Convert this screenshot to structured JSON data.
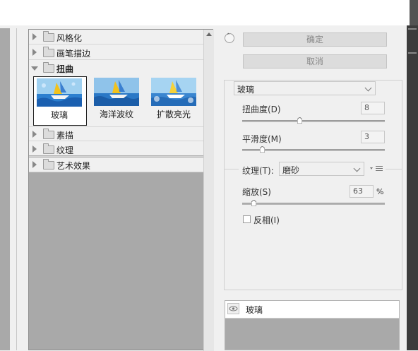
{
  "filter_tree": {
    "folders": [
      {
        "label": "风格化",
        "expanded": false
      },
      {
        "label": "画笔描边",
        "expanded": false
      },
      {
        "label": "扭曲",
        "expanded": true
      },
      {
        "label": "素描",
        "expanded": false
      },
      {
        "label": "纹理",
        "expanded": false
      },
      {
        "label": "艺术效果",
        "expanded": false
      }
    ],
    "thumbnails": [
      {
        "label": "玻璃",
        "selected": true
      },
      {
        "label": "海洋波纹",
        "selected": false
      },
      {
        "label": "扩散亮光",
        "selected": false
      }
    ]
  },
  "buttons": {
    "ok_label": "确定",
    "cancel_label": "取消"
  },
  "settings": {
    "filter_select": "玻璃",
    "distortion": {
      "label": "扭曲度(D)",
      "value": "8",
      "level": 0.4
    },
    "smoothness": {
      "label": "平滑度(M)",
      "value": "3",
      "level": 0.14
    },
    "texture": {
      "label": "纹理(T):",
      "value": "磨砂"
    },
    "scaling": {
      "label": "缩放(S)",
      "value": "63",
      "unit": "%",
      "level": 0.08
    },
    "invert": {
      "label": "反相(I)",
      "checked": false
    }
  },
  "layers": {
    "items": [
      {
        "name": "玻璃",
        "visible": true
      }
    ]
  },
  "colors": {
    "panel": "#f0f0f0",
    "gallery_bg": "#a9a9a9",
    "sail_yellow": "#f2c21b",
    "sea_blue": "#2c7fcf"
  }
}
